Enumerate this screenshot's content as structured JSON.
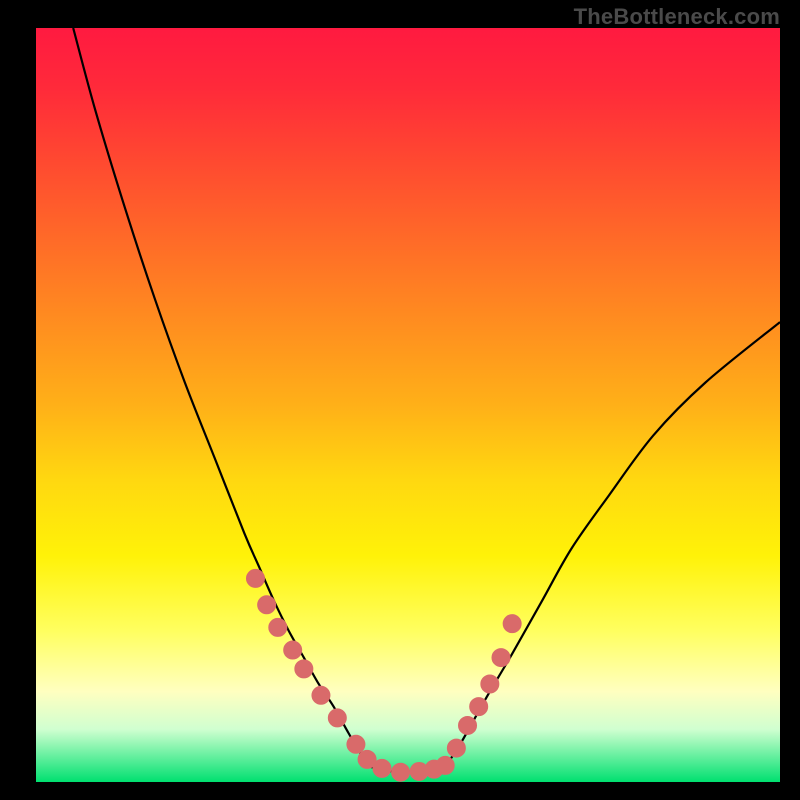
{
  "watermark": "TheBottleneck.com",
  "chart_data": {
    "type": "line",
    "title": "",
    "xlabel": "",
    "ylabel": "",
    "xlim": [
      0,
      100
    ],
    "ylim": [
      0,
      100
    ],
    "series": [
      {
        "name": "left-curve",
        "x": [
          5,
          8,
          12,
          16,
          20,
          24,
          28,
          30,
          32,
          34,
          36,
          38,
          40,
          42,
          43.5,
          45
        ],
        "y": [
          100,
          89,
          76,
          64,
          53,
          43,
          33,
          28.5,
          24,
          20,
          16.5,
          13,
          10,
          6.5,
          4,
          2
        ]
      },
      {
        "name": "right-curve",
        "x": [
          55,
          57,
          59,
          61,
          64,
          68,
          72,
          77,
          83,
          90,
          100
        ],
        "y": [
          2,
          5,
          8.5,
          12,
          17,
          24,
          31,
          38,
          46,
          53,
          61
        ]
      },
      {
        "name": "valley-bottom",
        "x": [
          45,
          47,
          49.5,
          52,
          55
        ],
        "y": [
          2,
          1.5,
          1.3,
          1.5,
          2
        ]
      }
    ],
    "scatter_points": {
      "name": "dots",
      "x": [
        29.5,
        31,
        32.5,
        34.5,
        36,
        38.3,
        40.5,
        43,
        44.5,
        46.5,
        49,
        51.5,
        53.5,
        55,
        56.5,
        58,
        59.5,
        61,
        62.5,
        64
      ],
      "y": [
        27,
        23.5,
        20.5,
        17.5,
        15,
        11.5,
        8.5,
        5,
        3,
        1.8,
        1.3,
        1.4,
        1.7,
        2.2,
        4.5,
        7.5,
        10,
        13,
        16.5,
        21
      ],
      "color": "#d96a6a",
      "radius": 9
    },
    "description": "A V-shaped black curve over a vertical rainbow gradient (red at top through orange, yellow, pale yellow, to green at the bottom). Salmon-colored dots are overlaid along the lower portions of both branches and across the bottom of the valley."
  }
}
